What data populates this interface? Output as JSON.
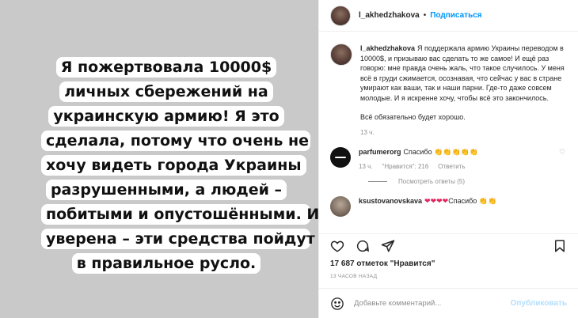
{
  "media": {
    "lines": [
      "Я пожертвовала 10000$",
      "личных сбережений на",
      "украинскую армию! Я это",
      "сделала, потому что очень не",
      "хочу видеть города Украины",
      "разрушенными, а людей –",
      "побитыми и опустошёнными. И",
      "уверена – эти средства пойдут",
      "в правильное русло."
    ]
  },
  "header": {
    "username": "l_akhedzhakova",
    "dot": "•",
    "follow_label": "Подписаться"
  },
  "caption": {
    "username": "l_akhedzhakova",
    "text": "Я поддержала армию Украины переводом в 10000$, и призываю вас сделать то же самое! И ещё раз говорю: мне правда очень жаль, что такое случилось. У меня всё в груди сжимается, осознавая, что сейчас у вас в стране умирают как ваши, так и наши парни. Где-то даже совсем молодые. И я искренне хочу, чтобы всё это закончилось.",
    "text2": "Всё обязательно будет хорошо.",
    "time": "13 ч."
  },
  "comments": [
    {
      "username": "parfumerorg",
      "text": "Спасибо",
      "emojis": "👏👏👏👏👏",
      "time": "13 ч.",
      "likes": "\"Нравится\": 216",
      "reply_label": "Ответить",
      "view_replies": "Посмотреть ответы (5)"
    },
    {
      "username": "ksustovanovskava",
      "hearts": "❤❤❤❤",
      "text": "Спасибо",
      "emojis": "👏👏"
    }
  ],
  "actions": {
    "like_icon": "heart-icon",
    "comment_icon": "comment-icon",
    "share_icon": "share-icon",
    "save_icon": "bookmark-icon"
  },
  "stats": {
    "likes": "17 687 отметок \"Нравится\"",
    "ago": "13 часов назад"
  },
  "add_comment": {
    "placeholder": "Добавьте комментарий...",
    "publish_label": "Опубликовать"
  }
}
